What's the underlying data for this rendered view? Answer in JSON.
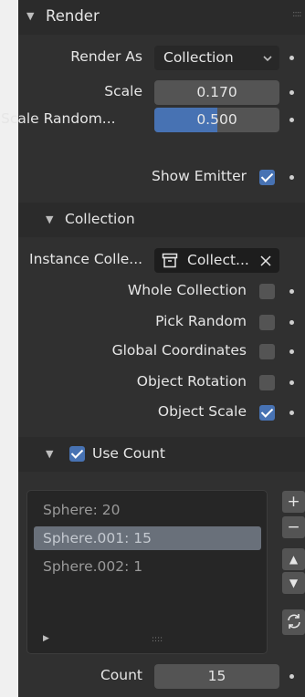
{
  "render_section": {
    "title": "Render",
    "render_as_label": "Render As",
    "render_as_value": "Collection",
    "scale_label": "Scale",
    "scale_value": "0.170",
    "scale_random_label": "Scale Random...",
    "scale_random_value": "0.500",
    "scale_random_fraction": 0.5,
    "show_emitter_label": "Show Emitter",
    "show_emitter_checked": true
  },
  "collection_section": {
    "title": "Collection",
    "instance_collection_label": "Instance Colle...",
    "instance_collection_value": "Collect...",
    "whole_collection_label": "Whole Collection",
    "pick_random_label": "Pick Random",
    "global_coordinates_label": "Global Coordinates",
    "object_rotation_label": "Object Rotation",
    "object_scale_label": "Object Scale",
    "checked": {
      "whole_collection": false,
      "pick_random": false,
      "global_coordinates": false,
      "object_rotation": false,
      "object_scale": true
    }
  },
  "use_count_section": {
    "title": "Use Count",
    "checked": true,
    "items": [
      {
        "label": "Sphere: 20",
        "selected": false
      },
      {
        "label": "Sphere.001: 15",
        "selected": true
      },
      {
        "label": "Sphere.002: 1",
        "selected": false
      }
    ],
    "grip": "::::",
    "count_label": "Count",
    "count_value": "15"
  },
  "icons": {
    "collapse": "triangle-down",
    "expand": "triangle-right",
    "dropdown": "chevron-down",
    "collection": "collection-box",
    "clear": "x",
    "add": "+",
    "remove": "−",
    "move_up": "▲",
    "move_down": "▼",
    "refresh": "refresh"
  },
  "colors": {
    "accent": "#4772b3",
    "panel": "#303030",
    "field": "#545454"
  }
}
